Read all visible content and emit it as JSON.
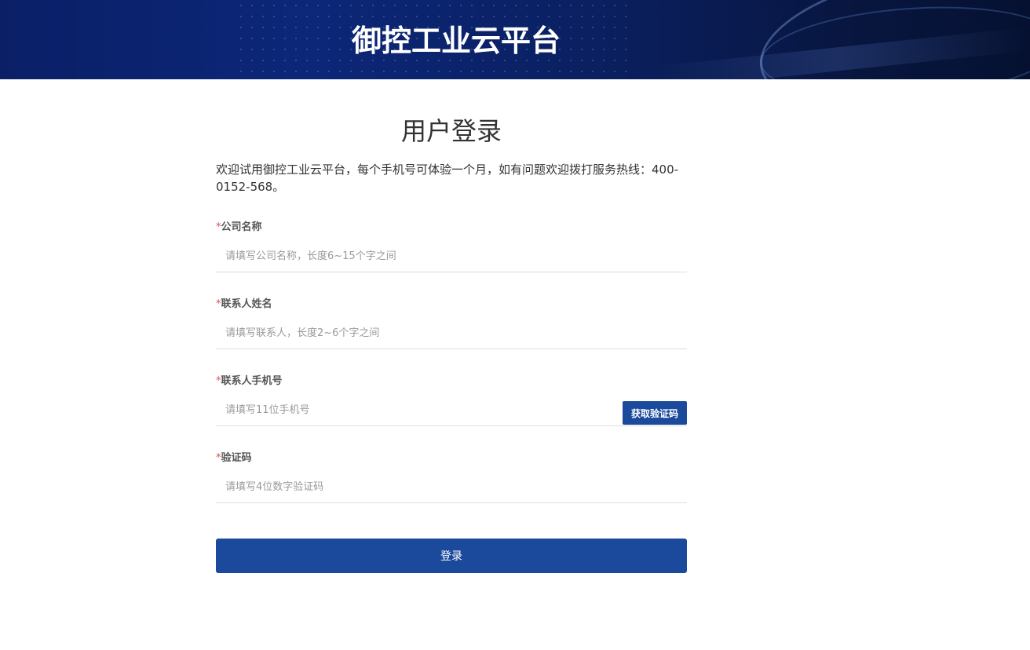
{
  "header": {
    "title": "御控工业云平台"
  },
  "page": {
    "title": "用户登录",
    "intro": "欢迎试用御控工业云平台，每个手机号可体验一个月，如有问题欢迎拨打服务热线：400-0152-568。"
  },
  "form": {
    "required_mark": "*",
    "company": {
      "label": "公司名称",
      "placeholder": "请填写公司名称，长度6~15个字之间"
    },
    "contact_name": {
      "label": "联系人姓名",
      "placeholder": "请填写联系人，长度2~6个字之间"
    },
    "phone": {
      "label": "联系人手机号",
      "placeholder": "请填写11位手机号",
      "code_button": "获取验证码"
    },
    "code": {
      "label": "验证码",
      "placeholder": "请填写4位数字验证码"
    },
    "submit_label": "登录"
  },
  "colors": {
    "primary": "#1b4a9c",
    "banner": "#0c2779",
    "required": "#d9534f"
  }
}
